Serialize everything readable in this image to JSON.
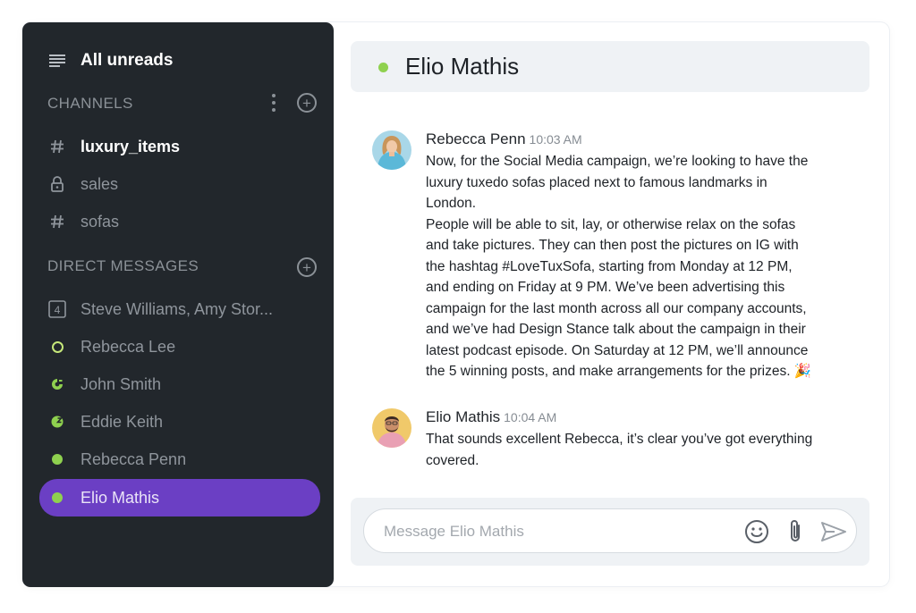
{
  "sidebar": {
    "unreads_label": "All unreads",
    "channels_title": "CHANNELS",
    "channels": [
      {
        "name": "luxury_items",
        "icon": "hash-icon",
        "active": true
      },
      {
        "name": "sales",
        "icon": "lock-icon",
        "active": false
      },
      {
        "name": "sofas",
        "icon": "hash-icon",
        "active": false
      }
    ],
    "dm_title": "DIRECT MESSAGES",
    "direct_messages": [
      {
        "name": "Steve Williams, Amy Stor...",
        "badge": "4",
        "icon": "group-count-icon"
      },
      {
        "name": "Rebecca Lee",
        "icon": "status-ring-icon"
      },
      {
        "name": "John Smith",
        "icon": "status-partial-icon"
      },
      {
        "name": "Eddie Keith",
        "icon": "status-sleep-icon"
      },
      {
        "name": "Rebecca Penn",
        "icon": "status-online-icon"
      },
      {
        "name": "Elio Mathis",
        "icon": "status-online-icon",
        "selected": true
      }
    ]
  },
  "chat": {
    "title": "Elio Mathis",
    "messages": [
      {
        "author": "Rebecca Penn",
        "time": "10:03 AM",
        "lines": [
          "Now, for the Social Media campaign, we’re looking to have the",
          "luxury tuxedo sofas placed next to famous landmarks in",
          "London.",
          "People will be able to sit, lay, or otherwise relax on the sofas",
          "and take pictures. They can then post the pictures on IG with",
          "the hashtag #LoveTuxSofa, starting from Monday at 12 PM,",
          "and ending on Friday at 9 PM. We’ve been advertising this",
          "campaign for the last month across all our company accounts,",
          "and we’ve had Design Stance talk about the campaign in their",
          "latest podcast episode. On Saturday at 12 PM, we’ll announce",
          "the 5 winning posts, and make arrangements for the prizes. 🎉"
        ]
      },
      {
        "author": "Elio Mathis",
        "time": "10:04 AM",
        "lines": [
          "That sounds excellent Rebecca, it’s clear you’ve got everything",
          "covered."
        ]
      }
    ],
    "composer": {
      "placeholder": "Message Elio Mathis",
      "value": ""
    }
  },
  "colors": {
    "sidebar_bg": "#22272c",
    "selected": "#6b3fc4",
    "online": "#8fd14f",
    "header_bg": "#eff2f5"
  }
}
